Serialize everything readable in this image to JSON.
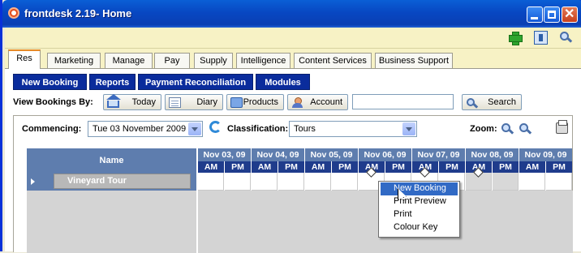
{
  "window": {
    "title": "frontdesk 2.19- Home"
  },
  "toolbar": {
    "icons": [
      "add-icon",
      "help-icon",
      "zoom-icon"
    ]
  },
  "tabs": [
    "Res",
    "Marketing",
    "Manage",
    "Pay",
    "Supply",
    "Intelligence",
    "Content Services",
    "Business Support"
  ],
  "subnav": [
    "New Booking",
    "Reports",
    "Payment Reconciliation",
    "Modules"
  ],
  "viewby": {
    "label": "View Bookings By:",
    "buttons": [
      "Today",
      "Diary",
      "Products",
      "Account"
    ],
    "search_value": "",
    "search_button": "Search"
  },
  "filters": {
    "commencing_label": "Commencing:",
    "commencing_value": "Tue 03 November  2009",
    "classification_label": "Classification:",
    "classification_value": "Tours",
    "zoom_label": "Zoom:"
  },
  "grid": {
    "name_header": "Name",
    "rows": [
      {
        "name": "Vineyard Tour"
      }
    ],
    "days": [
      "Nov 03, 09",
      "Nov 04, 09",
      "Nov 05, 09",
      "Nov 06, 09",
      "Nov 07, 09",
      "Nov 08, 09",
      "Nov 09, 09"
    ],
    "am": "AM",
    "pm": "PM"
  },
  "context_menu": {
    "items": [
      "New Booking",
      "Print Preview",
      "Print",
      "Colour Key"
    ],
    "highlighted": "New Booking"
  },
  "colors": {
    "title_bar": "#0a4fd0",
    "nav_button": "#0a2c9c",
    "grid_header": "#5e7dae",
    "grid_subheader": "#1f3c8c",
    "tab_active_accent": "#e78a27",
    "highlight": "#316ac5"
  }
}
